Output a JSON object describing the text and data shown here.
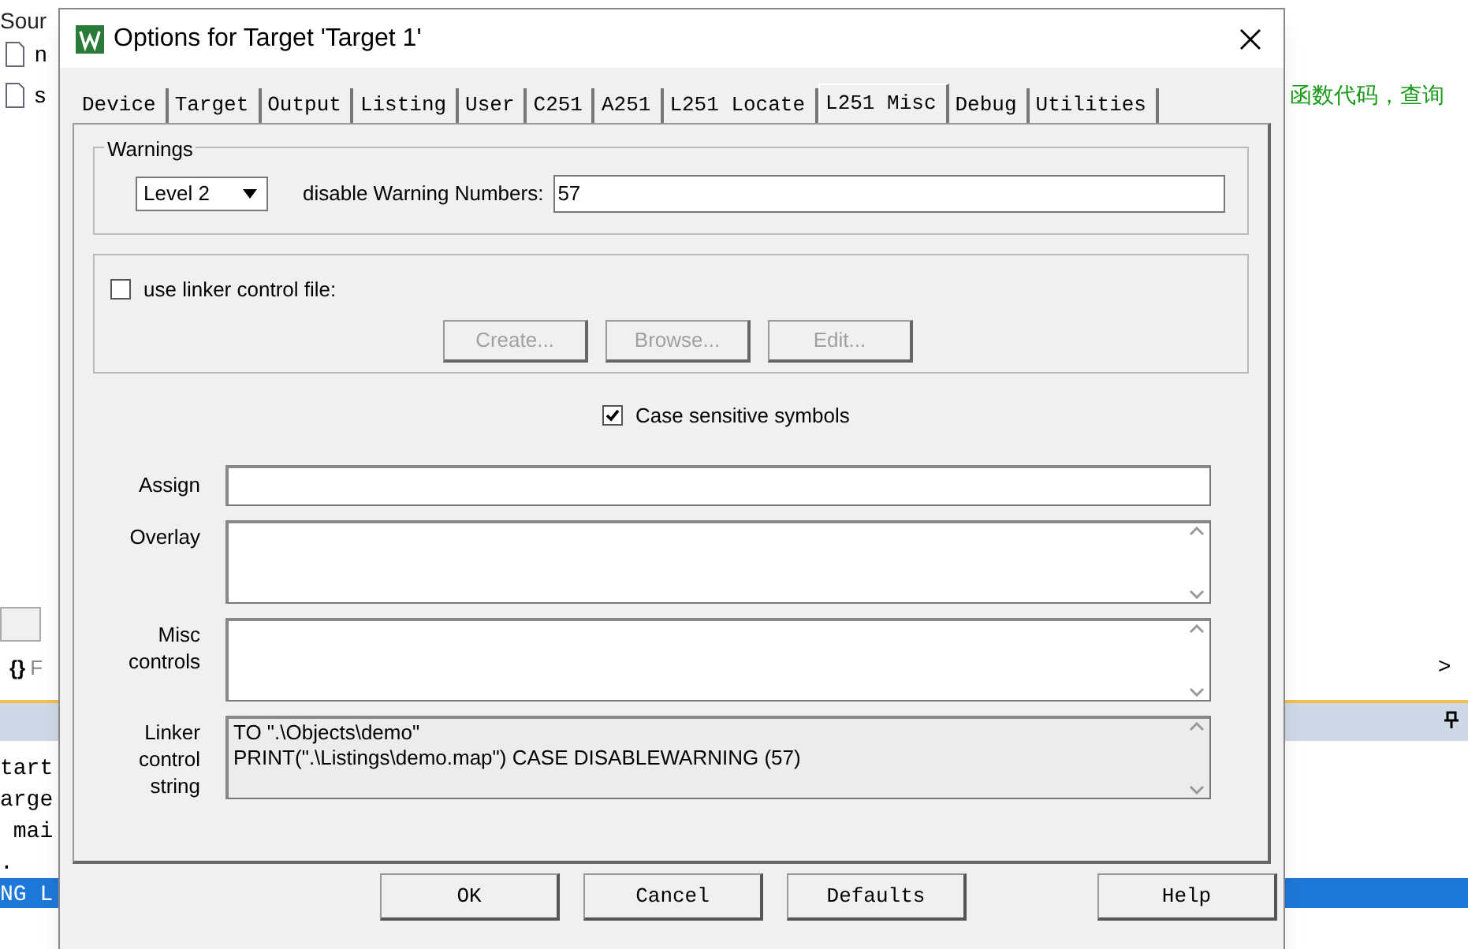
{
  "background": {
    "explorer_header": "Sour",
    "file_items": [
      "n",
      "s"
    ],
    "chinese_comment": "函数代码，查询",
    "panel_tab_icon": "{}",
    "panel_tab": "F",
    "scroll_arrow": ">",
    "code_lines": [
      "tart",
      "arge",
      " mai",
      "."
    ],
    "highlighted_line": "NG L"
  },
  "dialog": {
    "title": "Options for Target 'Target 1'",
    "tabs": [
      {
        "label": "Device",
        "selected": false
      },
      {
        "label": "Target",
        "selected": false
      },
      {
        "label": "Output",
        "selected": false
      },
      {
        "label": "Listing",
        "selected": false
      },
      {
        "label": "User",
        "selected": false
      },
      {
        "label": "C251",
        "selected": false
      },
      {
        "label": "A251",
        "selected": false
      },
      {
        "label": "L251 Locate",
        "selected": false
      },
      {
        "label": "L251 Misc",
        "selected": true
      },
      {
        "label": "Debug",
        "selected": false
      },
      {
        "label": "Utilities",
        "selected": false
      }
    ],
    "warnings": {
      "group_label": "Warnings",
      "level": "Level 2",
      "disable_label": "disable Warning Numbers:",
      "disable_value": "57"
    },
    "linker_file": {
      "label": "use linker control file:",
      "checked": false,
      "buttons": [
        {
          "label": "Create...",
          "disabled": true
        },
        {
          "label": "Browse...",
          "disabled": true
        },
        {
          "label": "Edit...",
          "disabled": true
        }
      ]
    },
    "case_sensitive": {
      "label": "Case sensitive symbols",
      "checked": true
    },
    "fields": [
      {
        "kind": "single",
        "label_lines": [
          "Assign"
        ]
      },
      {
        "kind": "multi",
        "label_lines": [
          "Overlay"
        ]
      },
      {
        "kind": "multi",
        "label_lines": [
          "Misc",
          "controls"
        ]
      },
      {
        "kind": "readonly",
        "label_lines": [
          "Linker",
          "control",
          "string"
        ],
        "lines": [
          "TO \".\\Objects\\demo\"",
          "PRINT(\".\\Listings\\demo.map\") CASE DISABLEWARNING (57)"
        ]
      }
    ],
    "buttons": [
      "OK",
      "Cancel",
      "Defaults",
      "Help"
    ]
  }
}
